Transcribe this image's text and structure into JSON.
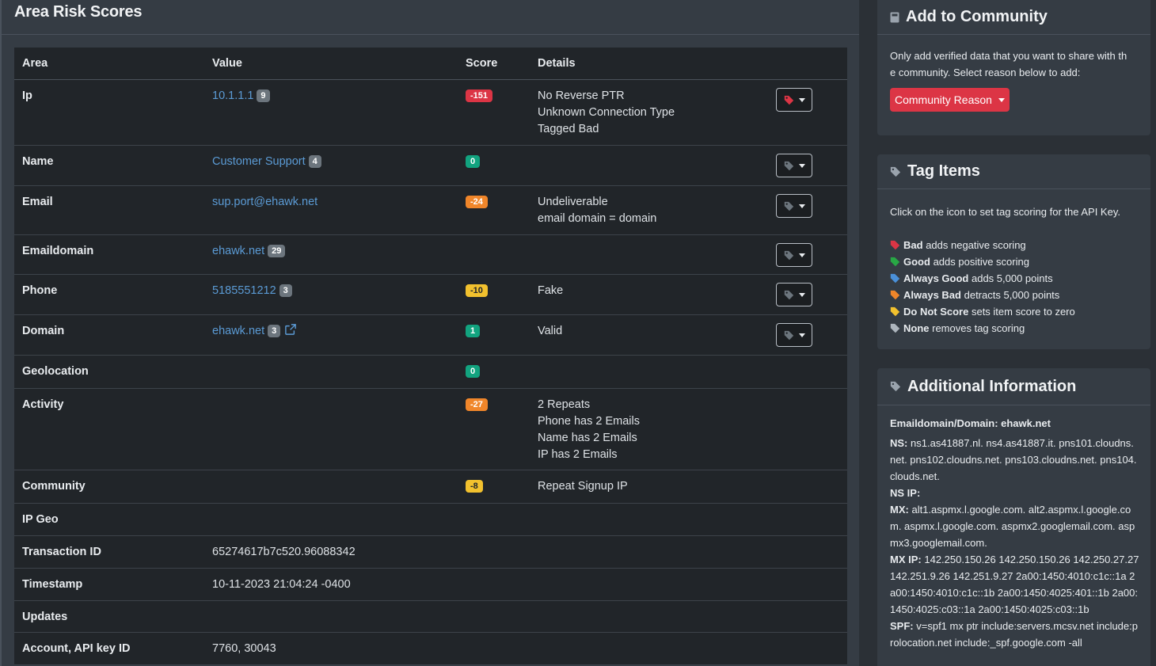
{
  "main": {
    "title": "Area Risk Scores",
    "columns": [
      "Area",
      "Value",
      "Score",
      "Details"
    ],
    "rows": [
      {
        "area": "Ip",
        "value": "10.1.1.1",
        "count": "9",
        "score": "-151",
        "details": [
          "No Reverse PTR",
          "Unknown Connection Type",
          "Tagged Bad"
        ]
      },
      {
        "area": "Name",
        "value": "Customer Support",
        "count": "4",
        "score": "0",
        "details": []
      },
      {
        "area": "Email",
        "value": "sup.port@ehawk.net",
        "score": "-24",
        "details": [
          "Undeliverable",
          "email domain = domain"
        ]
      },
      {
        "area": "Emaildomain",
        "value": "ehawk.net",
        "count": "29",
        "details": []
      },
      {
        "area": "Phone",
        "value": "5185551212",
        "count": "3",
        "score": "-10",
        "details": [
          "Fake"
        ]
      },
      {
        "area": "Domain",
        "value": "ehawk.net",
        "count": "3",
        "score": "1",
        "details": [
          "Valid"
        ]
      },
      {
        "area": "Geolocation",
        "score": "0",
        "details": []
      },
      {
        "area": "Activity",
        "score": "-27",
        "details": [
          "2 Repeats",
          "Phone has 2 Emails",
          "Name has 2 Emails",
          "IP has 2 Emails"
        ]
      },
      {
        "area": "Community",
        "score": "-8",
        "details": [
          "Repeat Signup IP"
        ]
      },
      {
        "area": "IP Geo"
      },
      {
        "area": "Transaction ID",
        "value": "65274617b7c520.96088342"
      },
      {
        "area": "Timestamp",
        "value": "10-11-2023 21:04:24 -0400"
      },
      {
        "area": "Updates"
      },
      {
        "area": "Account, API key ID",
        "value": "7760, 30043"
      }
    ]
  },
  "community": {
    "title": "Add to Community",
    "text_line1": "Only add verified data that you want to share with th",
    "text_line2": "e community. Select reason below to add:",
    "button_label": "Community Reason"
  },
  "tags": {
    "title": "Tag Items",
    "intro": "Click on the icon to set tag scoring for the API Key.",
    "legend": [
      {
        "label": "Bad",
        "desc": "adds negative scoring",
        "color": "#dc3545"
      },
      {
        "label": "Good",
        "desc": "adds positive scoring",
        "color": "#28a745"
      },
      {
        "label": "Always Good",
        "desc": "adds 5,000 points",
        "color": "#4a90d9"
      },
      {
        "label": "Always Bad",
        "desc": "detracts 5,000 points",
        "color": "#f0862a"
      },
      {
        "label": "Do Not Score",
        "desc": "sets item score to zero",
        "color": "#f2c12e"
      },
      {
        "label": "None",
        "desc": "removes tag scoring",
        "color": "#adb5bd"
      }
    ]
  },
  "additional": {
    "title": "Additional Information",
    "heading": "Emaildomain/Domain: ehawk.net",
    "ns_label": "NS:",
    "ns_value": "ns1.as41887.nl. ns4.as41887.it. pns101.cloudns.net. pns102.cloudns.net. pns103.cloudns.net. pns104.clouds.net.",
    "ns_ip_label": "NS IP:",
    "mx_label": "MX:",
    "mx_value": "alt1.aspmx.l.google.com. alt2.aspmx.l.google.com. aspmx.l.google.com. aspmx2.googlemail.com. aspmx3.googlemail.com.",
    "mx_ip_label": "MX IP:",
    "mx_ip_value": "142.250.150.26 142.250.150.26 142.250.27.27 142.251.9.26 142.251.9.27 2a00:1450:4010:c1c::1a 2a00:1450:4010:c1c::1b 2a00:1450:4025:401::1b 2a00:1450:4025:c03::1a 2a00:1450:4025:c03::1b",
    "spf_label": "SPF:",
    "spf_value": "v=spf1 mx ptr include:servers.mcsv.net include:prolocation.net include:_spf.google.com -all"
  },
  "colors": {
    "accent_red": "#dc3545",
    "link": "#5b9bd5",
    "score_green": "#12a37f",
    "score_orange": "#f0862a",
    "score_yellow": "#f2c12e"
  }
}
